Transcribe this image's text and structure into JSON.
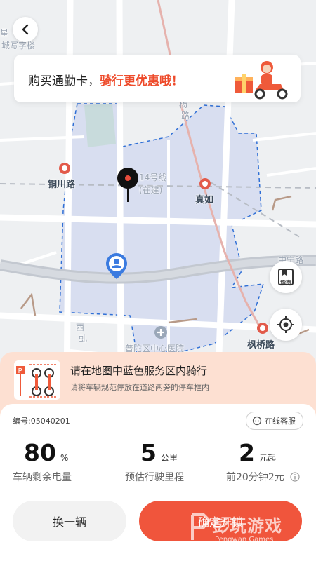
{
  "map": {
    "labels": {
      "top_left": "城写字楼",
      "top_left2": "星",
      "road_vert": "杨",
      "road_vert2": "路",
      "station1": "铜川路",
      "line14": "14号线",
      "line14_status": "(在建)",
      "station2": "真如",
      "station3": "枫桥路",
      "hospital": "普陀区中心医院",
      "west_road": "西",
      "west_road2": "虬",
      "right_edge": "中宁路"
    },
    "colors": {
      "service_area": "#2f6fd6",
      "metro": "#e25a4a"
    }
  },
  "promo": {
    "text_normal": "购买通勤卡，",
    "text_highlight": "骑行更优惠哦！"
  },
  "map_buttons": {
    "guide_label": "指南"
  },
  "notice": {
    "title": "请在地图中蓝色服务区内骑行",
    "subtitle": "请将车辆规范停放在道路两旁的停车框内",
    "parking_sign": "P"
  },
  "bike": {
    "code": "编号:05040201",
    "service_button": "在线客服",
    "battery": {
      "value": "80",
      "unit": "%",
      "label": "车辆剩余电量"
    },
    "distance": {
      "value": "5",
      "unit": "公里",
      "label": "预估行驶里程"
    },
    "price": {
      "value": "2",
      "unit": "元起",
      "label": "前20分钟2元"
    }
  },
  "actions": {
    "change": "换一辆",
    "unlock": "确定开锁"
  },
  "watermark": {
    "main": "彭玩游戏",
    "sub": "Pengwan Games"
  },
  "accent": "#f0553c"
}
